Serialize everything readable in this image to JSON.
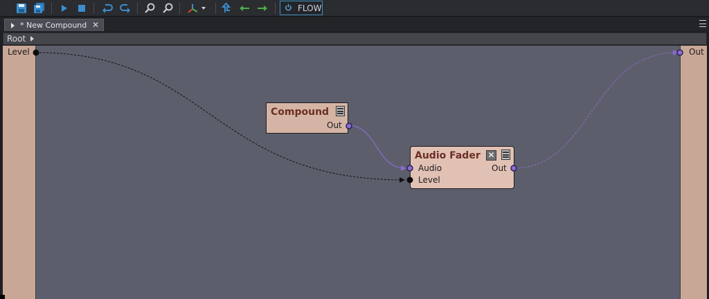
{
  "toolbar": {
    "icons": [
      "save-icon",
      "save-all-icon",
      "play-icon",
      "stop-icon",
      "undo-icon",
      "redo-icon",
      "zoom-in-icon",
      "zoom-out-icon",
      "axis-gizmo-icon",
      "navigate-up-icon",
      "back-arrow-icon",
      "forward-arrow-icon",
      "power-icon"
    ],
    "flow_label": "FLOW",
    "accent": "#3d8fbf"
  },
  "tab": {
    "label": "* New Compound",
    "close_glyph": "✕"
  },
  "breadcrumb": {
    "label": "Root"
  },
  "graph": {
    "inputs_panel": {
      "port_label": "Level"
    },
    "outputs_panel": {
      "port_label": "Out"
    },
    "nodes": {
      "compound": {
        "title": "Compound",
        "out_label": "Out",
        "color": "#d4b5a5"
      },
      "audio_fader": {
        "title": "Audio Fader",
        "audio_label": "Audio",
        "level_label": "Level",
        "out_label": "Out",
        "close_glyph": "✕",
        "color": "#e2c1b5"
      }
    },
    "colors": {
      "canvas": "#5c5f6b",
      "io_panel": "#c9a797",
      "audio_link": "#8a6bd1",
      "control_link": "#111111"
    }
  }
}
